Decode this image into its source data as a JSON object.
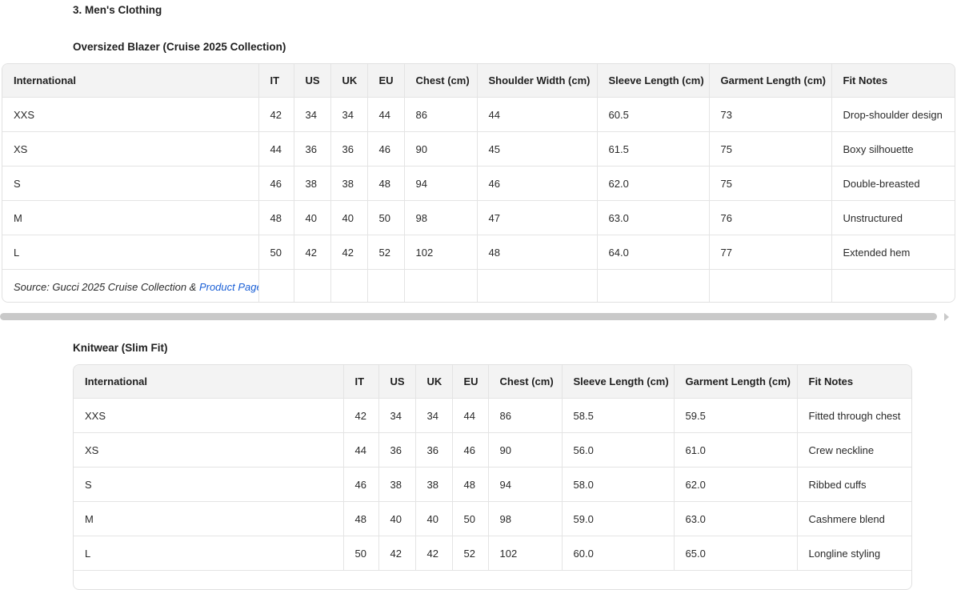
{
  "section_heading": "3. Men's Clothing",
  "blazer": {
    "heading": "Oversized Blazer (Cruise 2025 Collection)",
    "columns": [
      "International",
      "IT",
      "US",
      "UK",
      "EU",
      "Chest (cm)",
      "Shoulder Width (cm)",
      "Sleeve Length (cm)",
      "Garment Length (cm)",
      "Fit Notes"
    ],
    "rows": [
      [
        "XXS",
        "42",
        "34",
        "34",
        "44",
        "86",
        "44",
        "60.5",
        "73",
        "Drop-shoulder design"
      ],
      [
        "XS",
        "44",
        "36",
        "36",
        "46",
        "90",
        "45",
        "61.5",
        "75",
        "Boxy silhouette"
      ],
      [
        "S",
        "46",
        "38",
        "38",
        "48",
        "94",
        "46",
        "62.0",
        "75",
        "Double-breasted"
      ],
      [
        "M",
        "48",
        "40",
        "40",
        "50",
        "98",
        "47",
        "63.0",
        "76",
        "Unstructured"
      ],
      [
        "L",
        "50",
        "42",
        "42",
        "52",
        "102",
        "48",
        "64.0",
        "77",
        "Extended hem"
      ]
    ],
    "source_prefix": "Source: Gucci 2025 Cruise Collection & ",
    "source_link": "Product Page"
  },
  "knitwear": {
    "heading": "Knitwear (Slim Fit)",
    "columns": [
      "International",
      "IT",
      "US",
      "UK",
      "EU",
      "Chest (cm)",
      "Sleeve Length (cm)",
      "Garment Length (cm)",
      "Fit Notes"
    ],
    "rows": [
      [
        "XXS",
        "42",
        "34",
        "34",
        "44",
        "86",
        "58.5",
        "59.5",
        "Fitted through chest"
      ],
      [
        "XS",
        "44",
        "36",
        "36",
        "46",
        "90",
        "56.0",
        "61.0",
        "Crew neckline"
      ],
      [
        "S",
        "46",
        "38",
        "38",
        "48",
        "94",
        "58.0",
        "62.0",
        "Ribbed cuffs"
      ],
      [
        "M",
        "48",
        "40",
        "40",
        "50",
        "98",
        "59.0",
        "63.0",
        "Cashmere blend"
      ],
      [
        "L",
        "50",
        "42",
        "42",
        "52",
        "102",
        "60.0",
        "65.0",
        "Longline styling"
      ]
    ]
  }
}
